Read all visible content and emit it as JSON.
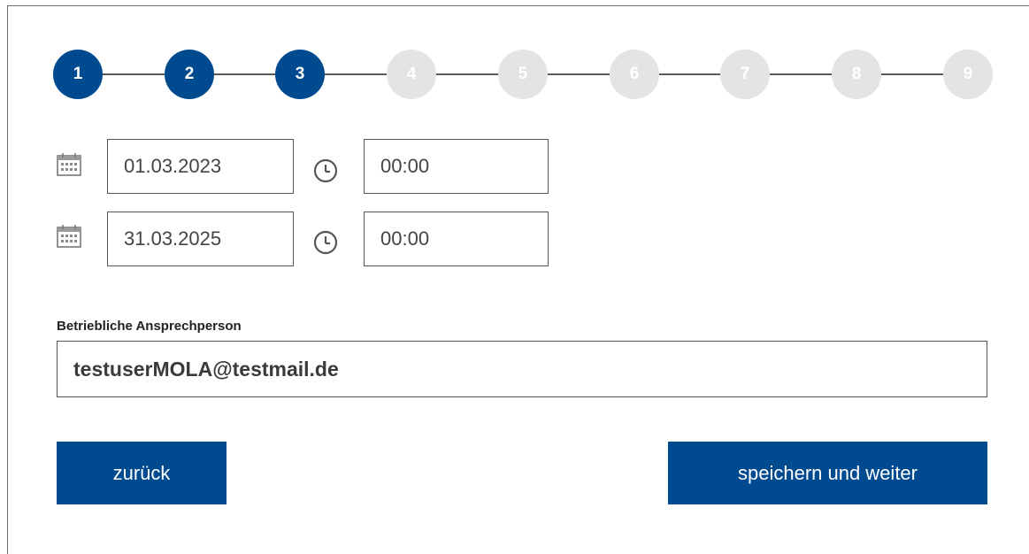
{
  "stepper": {
    "steps": [
      "1",
      "2",
      "3",
      "4",
      "5",
      "6",
      "7",
      "8",
      "9"
    ],
    "current_step": 3,
    "colors": {
      "done": "#004a8f",
      "todo": "#e4e4e4"
    }
  },
  "period": {
    "start": {
      "date": "01.03.2023",
      "time": "00:00"
    },
    "end": {
      "date": "31.03.2025",
      "time": "00:00"
    },
    "icons": {
      "date": "calendar-icon",
      "time": "clock-icon"
    }
  },
  "contact": {
    "label": "Betriebliche Ansprechperson",
    "value": "testuserMOLA@testmail.de"
  },
  "actions": {
    "back_label": "zurück",
    "save_label": "speichern und weiter",
    "color": "#004a8f"
  }
}
